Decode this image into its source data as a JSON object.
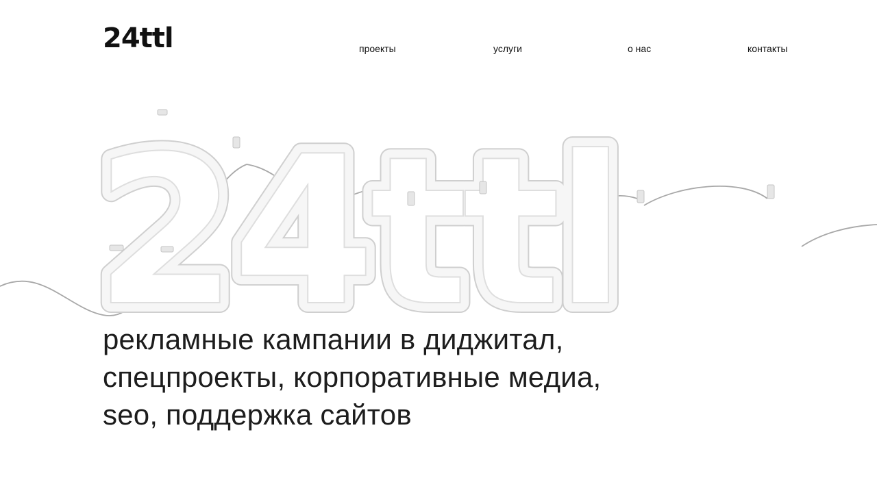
{
  "header": {
    "logo_text": "24ttl",
    "nav": [
      {
        "label": "проекты"
      },
      {
        "label": "услуги"
      },
      {
        "label": "о нас"
      },
      {
        "label": "контакты"
      }
    ]
  },
  "hero": {
    "art_text": "24ttl",
    "tagline_lines": [
      "рекламные кампании в диджитал,",
      "спецпроекты, корпоративные медиа,",
      "seo, поддержка сайтов"
    ]
  },
  "colors": {
    "background": "#ffffff",
    "text": "#1a1a1a",
    "neon_tube": "#f2f2f2",
    "neon_outline": "#d4d4d4",
    "cable": "#a0a0a0"
  }
}
